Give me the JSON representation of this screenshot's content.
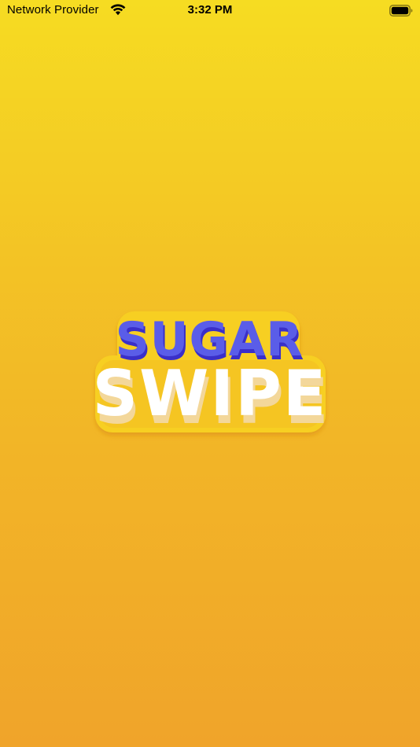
{
  "status_bar": {
    "carrier": "Network Provider",
    "time": "3:32 PM",
    "wifi_icon": "wifi-icon",
    "battery_icon": "battery-icon"
  },
  "splash": {
    "logo_line1": "SUGAR",
    "logo_line2": "SWIPE",
    "colors": {
      "background_top": "#f6dc22",
      "background_bottom": "#f0a42a",
      "logo_outline": "#f7cf22",
      "logo_line1_fill": "#5a5de8",
      "logo_line1_shadow": "#3a2fc9",
      "logo_line2_fill": "#ffffff",
      "logo_line2_shadow": "#f3d79a"
    }
  }
}
